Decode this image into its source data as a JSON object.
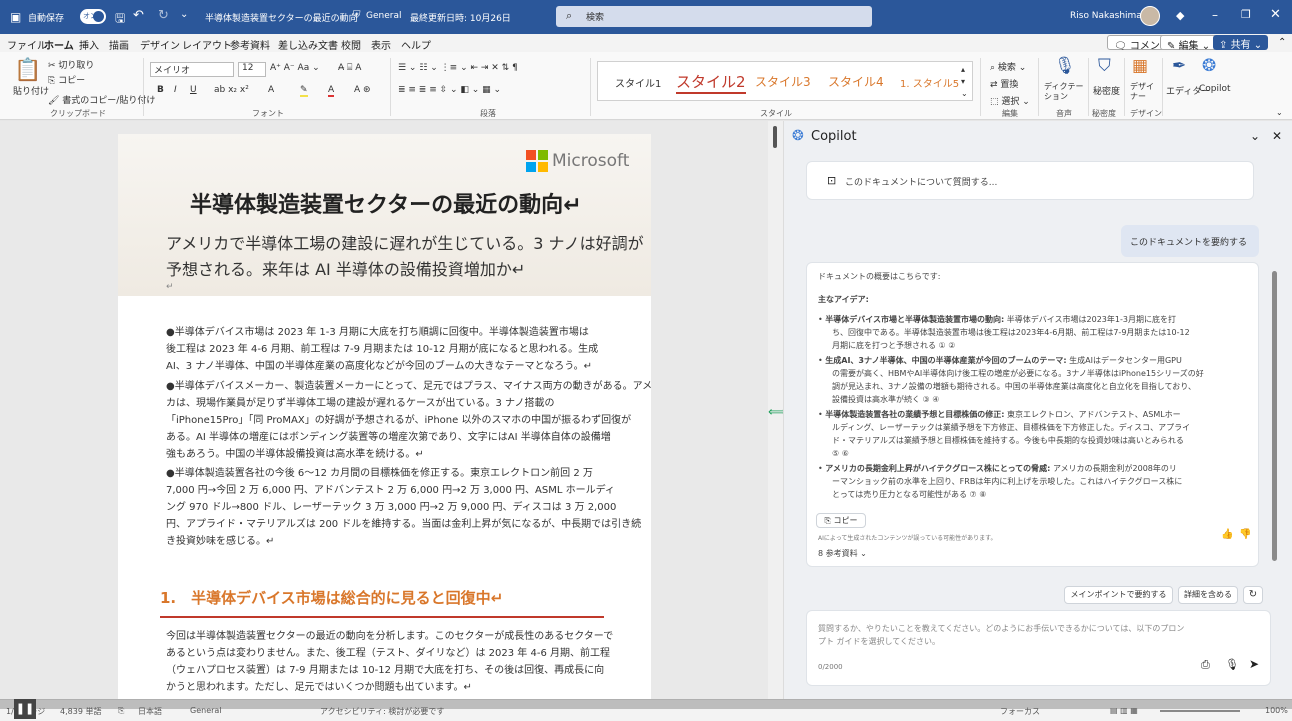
{
  "titlebar": {
    "autosave_label": "自動保存",
    "autosave_state": "オン",
    "doc_title": "半導体製造装置セクターの最近の動向",
    "sensitivity": "General",
    "last_saved": "最終更新日時: 10月26日",
    "search_placeholder": "検索",
    "user_name": "Riso Nakashima"
  },
  "menu": [
    "ファイル",
    "ホーム",
    "挿入",
    "描画",
    "デザイン",
    "レイアウト",
    "参考資料",
    "差し込み文書",
    "校閲",
    "表示",
    "ヘルプ"
  ],
  "menu_active": "ホーム",
  "menu_right": {
    "comment_label": "コメント",
    "edit_label": "編集",
    "share_label": "共有"
  },
  "ribbon": {
    "paste_label": "貼り付け",
    "cut_label": "切り取り",
    "copy_label": "コピー",
    "format_painter_label": "書式のコピー/貼り付け",
    "clipboard_group": "クリップボード",
    "font_name": "メイリオ",
    "font_size": "12",
    "font_group": "フォント",
    "paragraph_group": "段落",
    "styles": [
      "スタイル1",
      "スタイル2",
      "スタイル3",
      "スタイル4",
      "1. スタイル5"
    ],
    "styles_group": "スタイル",
    "find_label": "検索",
    "replace_label": "置換",
    "select_label": "選択",
    "editing_group": "編集",
    "dictate_label": "ディクテーション",
    "voice_group": "音声",
    "sensitivity_label": "秘密度",
    "sensitivity_group": "秘密度",
    "designer_label": "デザイナー",
    "designer_group": "デザイン",
    "editor_label": "エディター",
    "copilot_label": "Copilot"
  },
  "document": {
    "logo_text": "Microsoft",
    "title": "半導体製造装置セクターの最近の動向↵",
    "subtitle_line1": "アメリカで半導体工場の建設に遅れが生じている。3 ナノは好調が",
    "subtitle_line2": "予想される。来年は AI 半導体の設備投資増加か↵",
    "para_mark": "↵",
    "bullet1": [
      "●半導体デバイス市場は 2023 年 1-3 月期に大底を打ち順調に回復中。半導体製造装置市場は",
      "後工程は 2023 年 4-6 月期、前工程は 7-9 月期または 10-12 月期が底になると思われる。生成",
      "AI、3 ナノ半導体、中国の半導体産業の高度化などが今回のブームの大きなテーマとなろう。↵"
    ],
    "bullet2": [
      "●半導体デバイスメーカー、製造装置メーカーにとって、足元ではプラス、マイナス両方の動きがある。アメリ",
      "カは、現場作業員が足りず半導体工場の建設が遅れるケースが出ている。3 ナノ搭載の",
      "「iPhone15Pro」「同 ProMAX」の好調が予想されるが、iPhone 以外のスマホの中国が振るわず回復が",
      "ある。AI 半導体の増産にはボンディング装置等の増産次第であり、文字にはAI 半導体自体の設備増",
      "強もあろう。中国の半導体設備投資は高水準を続ける。↵"
    ],
    "bullet3": [
      "●半導体製造装置各社の今後 6～12 カ月間の目標株価を修正する。東京エレクトロン前回 2 万",
      "7,000 円→今回 2 万 6,000 円、アドバンテスト 2 万 6,000 円→2 万 3,000 円、ASML ホールディ",
      "ング 970 ドル→800 ドル、レーザーテック 3 万 3,000 円→2 万 9,000 円、ディスコは 3 万 2,000",
      "円、アプライド・マテリアルズは 200 ドルを維持する。当面は金利上昇が気になるが、中長期では引き続",
      "き投資妙味を感じる。↵"
    ],
    "heading1": "1.　半導体デバイス市場は総合的に見ると回復中↵",
    "body1": [
      "今回は半導体製造装置セクターの最近の動向を分析します。このセクターが成長性のあるセクターで",
      "あるという点は変わりません。また、後工程（テスト、ダイリなど）は 2023 年 4-6 月期、前工程",
      "（ウェハプロセス装置）は 7-9 月期または 10-12 月期で大底を打ち、その後は回復、再成長に向",
      "かうと思われます。ただし、足元ではいくつか問題も出ています。↵"
    ]
  },
  "copilot": {
    "title": "Copilot",
    "prompt_suggestion": "このドキュメントについて質問する...",
    "user_message": "このドキュメントを要約する",
    "response_intro": "ドキュメントの概要はこちらです:",
    "main_ideas_label": "主なアイデア:",
    "bullets": [
      {
        "bold": "半導体デバイス市場と半導体製造装置市場の動向:",
        "lines": [
          "半導体デバイス市場は2023年1-3月期に底を打",
          "ち、回復中である。半導体製造装置市場は後工程は2023年4-6月期、前工程は7-9月期または10-12",
          "月期に底を打つと予想される ① ②"
        ]
      },
      {
        "bold": "生成AI、3ナノ半導体、中国の半導体産業が今回のブームのテーマ:",
        "lines": [
          "生成AIはデータセンター用GPU",
          "の需要が高く、HBMやAI半導体向け後工程の増産が必要になる。3ナノ半導体はiPhone15シリーズの好",
          "調が見込まれ、3ナノ設備の増額も期待される。中国の半導体産業は高度化と自立化を目指しており、",
          "設備投資は高水準が続く ③ ④"
        ]
      },
      {
        "bold": "半導体製造装置各社の業績予想と目標株価の修正:",
        "lines": [
          "東京エレクトロン、アドバンテスト、ASMLホー",
          "ルディング、レーザーテックは業績予想を下方修正、目標株価を下方修正した。ディスコ、アプライ",
          "ド・マテリアルズは業績予想と目標株価を維持する。今後も中長期的な投資妙味は高いとみられる",
          "⑤ ⑥"
        ]
      },
      {
        "bold": "アメリカの長期金利上昇がハイテクグロース株にとっての脅威:",
        "lines": [
          "アメリカの長期金利が2008年のリ",
          "ーマンショック前の水準を上回り、FRBは年内に利上げを示唆した。これはハイテクグロース株に",
          "とっては売り圧力となる可能性がある ⑦ ⑧"
        ]
      }
    ],
    "copy_label": "コピー",
    "disclaimer": "AIによって生成されたコンテンツが誤っている可能性があります。",
    "references_label": "8 参考資料",
    "suggestion_1": "メインポイントで要約する",
    "suggestion_2": "詳細を含める",
    "input_placeholder_line1": "質問するか、やりたいことを教えてください。どのようにお手伝いできるかについては、以下のプロン",
    "input_placeholder_line2": "プト ガイドを選択してください。",
    "char_count": "0/2000"
  },
  "statusbar": {
    "page_info": "1/6 ページ",
    "word_count": "4,839 単語",
    "language": "日本語",
    "sensitivity": "General",
    "accessibility": "アクセシビリティ: 検討が必要です",
    "focus": "フォーカス",
    "zoom": "100%"
  },
  "colors": {
    "accent": "#2b579a",
    "heading": "#d9772b",
    "heading_rule": "#c0392b",
    "style2": "#c0392b",
    "copilot_pill": "#dfe6f2"
  }
}
